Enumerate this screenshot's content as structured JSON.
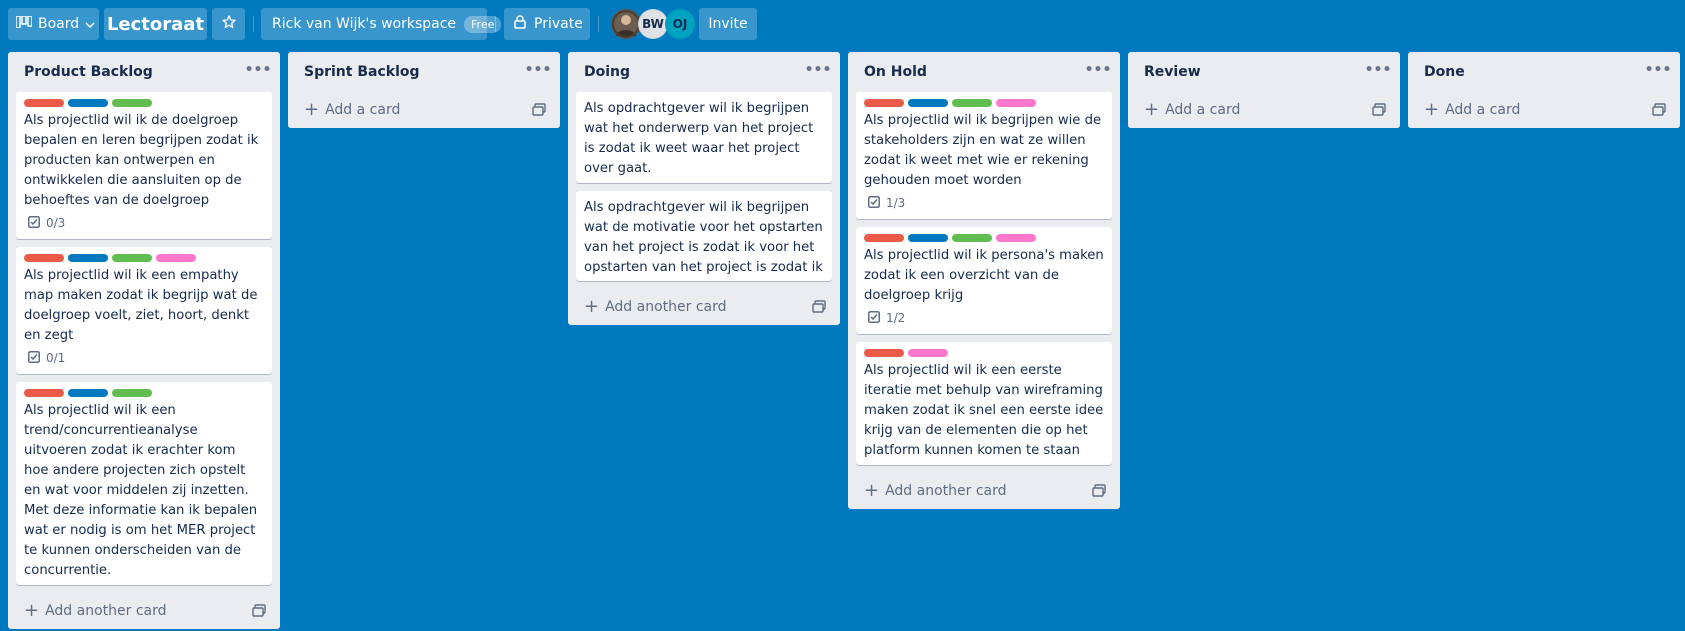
{
  "header": {
    "view_label": "Board",
    "board_title": "Lectoraat",
    "workspace": "Rick van Wijk's workspace",
    "workspace_badge": "Free",
    "privacy": "Private",
    "members": [
      "BW",
      "OJ"
    ],
    "invite": "Invite"
  },
  "colors": {
    "background": "#0079bf",
    "label_red": "#eb5a46",
    "label_blue": "#0079bf",
    "label_green": "#61bd4f",
    "label_pink": "#ff78cb"
  },
  "lists": [
    {
      "title": "Product Backlog",
      "add_label": "Add another card",
      "cards": [
        {
          "text": "Als projectlid wil ik de doelgroep bepalen en leren begrijpen zodat ik producten kan ontwerpen en ontwikkelen die aansluiten op de behoeftes van de doelgroep",
          "checklist": "0/3"
        },
        {
          "text": "Als projectlid wil ik een empathy map maken zodat ik begrijp wat de doelgroep voelt, ziet, hoort, denkt en zegt",
          "checklist": "0/1"
        },
        {
          "text": "Als projectlid wil ik een trend/concurrentieanalyse uitvoeren zodat ik erachter kom hoe andere projecten zich opstelt en wat voor middelen zij inzetten. Met deze informatie kan ik bepalen wat er nodig is om het MER project te kunnen onderscheiden van de concurrentie."
        }
      ]
    },
    {
      "title": "Sprint Backlog",
      "add_label": "Add a card",
      "cards": []
    },
    {
      "title": "Doing",
      "add_label": "Add another card",
      "cards": [
        {
          "text": "Als opdrachtgever wil ik begrijpen wat het onderwerp van het project is zodat ik weet waar het project over gaat."
        },
        {
          "text": "Als opdrachtgever wil ik begrijpen wat de motivatie voor het opstarten van het project is zodat ik voor het opstarten van het project is zodat ik"
        }
      ]
    },
    {
      "title": "On Hold",
      "add_label": "Add another card",
      "cards": [
        {
          "text": "Als projectlid wil ik begrijpen wie de stakeholders zijn en wat ze willen zodat ik weet met wie er rekening gehouden moet worden",
          "checklist": "1/3"
        },
        {
          "text": "Als projectlid wil ik persona's maken zodat ik een overzicht van de doelgroep krijg",
          "checklist": "1/2"
        },
        {
          "text": "Als projectlid wil ik een eerste iteratie met behulp van wireframing maken zodat ik snel een eerste idee krijg van de elementen die op het platform kunnen komen te staan"
        }
      ]
    },
    {
      "title": "Review",
      "add_label": "Add a card",
      "cards": []
    },
    {
      "title": "Done",
      "add_label": "Add a card",
      "cards": []
    }
  ]
}
